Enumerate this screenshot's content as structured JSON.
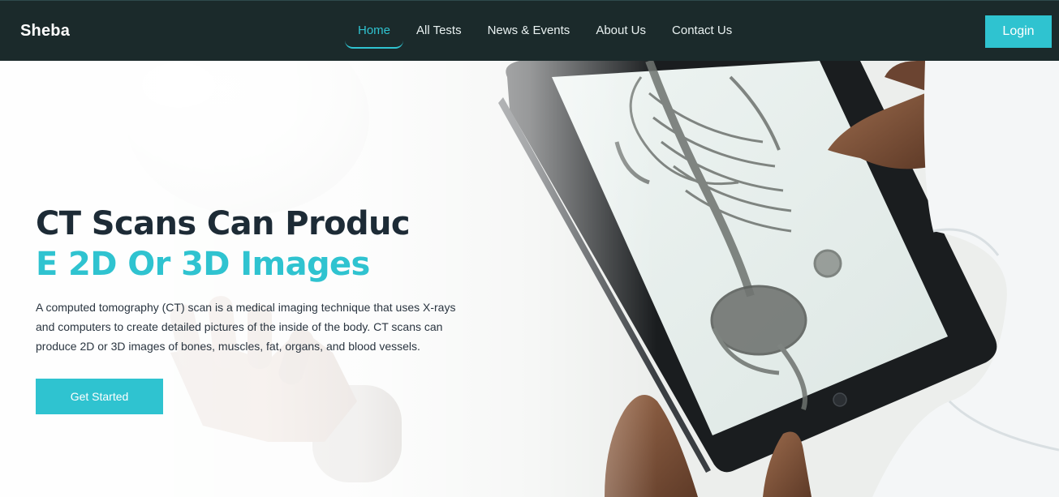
{
  "navbar": {
    "brand": "Sheba",
    "links": [
      {
        "label": "Home",
        "active": true
      },
      {
        "label": "All Tests"
      },
      {
        "label": "News & Events"
      },
      {
        "label": "About Us"
      },
      {
        "label": "Contact Us"
      }
    ],
    "login_label": "Login"
  },
  "hero": {
    "title_line1": "CT Scans Can Produc",
    "title_line2": "E 2D Or 3D Images",
    "description": "A computed tomography (CT) scan is a medical imaging technique that uses X-rays and computers to create detailed pictures of the inside of the body. CT scans can produce 2D or 3D images of bones, muscles, fat, organs, and blood vessels.",
    "cta_label": "Get Started"
  },
  "colors": {
    "navbar_bg": "#1b2a2b",
    "accent": "#2fc3d0",
    "heading_dark": "#1d2b36"
  }
}
